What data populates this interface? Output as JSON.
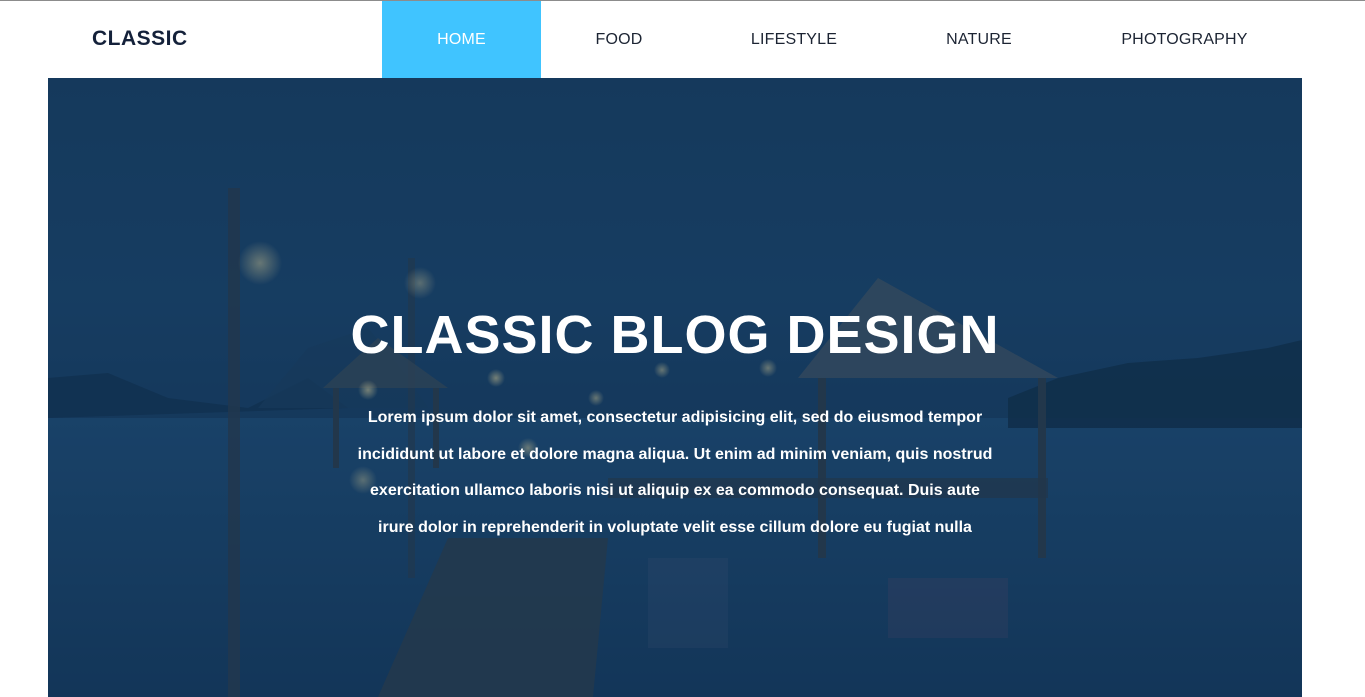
{
  "header": {
    "logo": "CLASSIC",
    "nav": [
      {
        "label": "HOME",
        "active": true
      },
      {
        "label": "FOOD",
        "active": false
      },
      {
        "label": "LIFESTYLE",
        "active": false
      },
      {
        "label": "NATURE",
        "active": false
      },
      {
        "label": "PHOTOGRAPHY",
        "active": false
      }
    ]
  },
  "hero": {
    "title": "CLASSIC BLOG DESIGN",
    "text": "Lorem ipsum dolor sit amet, consectetur adipisicing elit, sed do eiusmod tempor incididunt ut labore et dolore magna aliqua. Ut enim ad minim veniam, quis nostrud exercitation ullamco laboris nisi ut aliquip ex ea commodo consequat. Duis aute irure dolor in reprehenderit in voluptate velit esse cillum dolore eu fugiat nulla"
  },
  "colors": {
    "accent": "#40c4ff",
    "logo": "#14213a",
    "hero_bg": "#173d60"
  }
}
